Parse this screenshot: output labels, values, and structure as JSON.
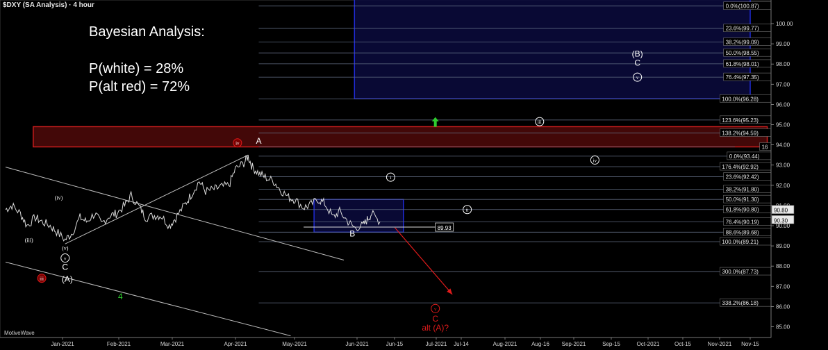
{
  "header": {
    "title": "$DXY (SA Analysis) · 4 hour"
  },
  "annotation": {
    "heading": "Bayesian Analysis:",
    "line1": "P(white) = 28%",
    "line2": "P(alt red) = 72%"
  },
  "footer": {
    "brand": "MotiveWave"
  },
  "colors": {
    "background": "#000000",
    "price": "#d9d9d9",
    "grid": "#5f6a80",
    "red_zone_fill": "#5a0b0b",
    "red_zone_stroke": "#cc1d1d",
    "blue_zone_fill": "#0a0a3d",
    "blue_zone_stroke": "#1f2bd6",
    "white_wave": "#ffffff",
    "red_wave": "#e01b1b",
    "green_wave": "#2ecc2e"
  },
  "chart_data": {
    "type": "line",
    "title": "$DXY (SA Analysis) · 4 hour",
    "xlabel": "",
    "ylabel": "",
    "x_ticks": [
      "Jan-2021",
      "Feb-2021",
      "Mar-2021",
      "Apr-2021",
      "May-2021",
      "Jun-2021",
      "Jun-15",
      "Jul-2021",
      "Jul-14",
      "Aug-2021",
      "Aug-16",
      "Sep-2021",
      "Sep-15",
      "Oct-2021",
      "Oct-15",
      "Nov-2021",
      "Nov-15"
    ],
    "y_ticks": [
      "100.00",
      "99.00",
      "98.00",
      "97.00",
      "96.00",
      "95.00",
      "94.00",
      "93.00",
      "92.00",
      "91.00",
      "90.00",
      "89.00",
      "88.00",
      "87.00",
      "86.00",
      "85.00"
    ],
    "ylim": [
      84.5,
      101.2
    ],
    "price_markers": [
      {
        "label": "90.80",
        "value": 90.8
      },
      {
        "label": "90.30",
        "value": 90.3
      }
    ],
    "fib_levels": [
      {
        "label": "0.0%(100.87)",
        "value": 100.87
      },
      {
        "label": "23.6%(99.77)",
        "value": 99.77
      },
      {
        "label": "38.2%(99.09)",
        "value": 99.09
      },
      {
        "label": "50.0%(98.55)",
        "value": 98.55
      },
      {
        "label": "61.8%(98.01)",
        "value": 98.01
      },
      {
        "label": "76.4%(97.35)",
        "value": 97.35
      },
      {
        "label": "100.0%(96.28)",
        "value": 96.28
      },
      {
        "label": "123.6%(95.23)",
        "value": 95.23
      },
      {
        "label": "138.2%(94.59)",
        "value": 94.59
      },
      {
        "label": "16",
        "value": 93.9
      },
      {
        "label": "0.0%(93.44)",
        "value": 93.44
      },
      {
        "label": "176.4%(92.92)",
        "value": 92.92
      },
      {
        "label": "23.6%(92.42)",
        "value": 92.42
      },
      {
        "label": "38.2%(91.80)",
        "value": 91.8
      },
      {
        "label": "50.0%(91.30)",
        "value": 91.3
      },
      {
        "label": "61.8%(90.80)",
        "value": 90.8
      },
      {
        "label": "76.4%(90.19)",
        "value": 90.19
      },
      {
        "label": "88.6%(89.68)",
        "value": 89.68
      },
      {
        "label": "100.0%(89.21)",
        "value": 89.21
      },
      {
        "label": "300.0%(87.73)",
        "value": 87.73
      },
      {
        "label": "338.2%(86.18)",
        "value": 86.18
      }
    ],
    "price_callout": {
      "label": "89.93",
      "value": 89.93
    },
    "price_path": [
      [
        "2020-12-07",
        90.8
      ],
      [
        "2020-12-10",
        91.0
      ],
      [
        "2020-12-14",
        90.6
      ],
      [
        "2020-12-17",
        90.0
      ],
      [
        "2020-12-21",
        90.4
      ],
      [
        "2020-12-24",
        90.2
      ],
      [
        "2020-12-28",
        90.0
      ],
      [
        "2020-12-31",
        89.7
      ],
      [
        "2021-01-04",
        89.3
      ],
      [
        "2021-01-07",
        89.6
      ],
      [
        "2021-01-11",
        90.4
      ],
      [
        "2021-01-14",
        90.2
      ],
      [
        "2021-01-18",
        90.6
      ],
      [
        "2021-01-21",
        90.1
      ],
      [
        "2021-01-25",
        90.5
      ],
      [
        "2021-01-28",
        90.6
      ],
      [
        "2021-02-01",
        91.0
      ],
      [
        "2021-02-04",
        91.5
      ],
      [
        "2021-02-08",
        90.9
      ],
      [
        "2021-02-11",
        90.4
      ],
      [
        "2021-02-15",
        90.5
      ],
      [
        "2021-02-18",
        90.5
      ],
      [
        "2021-02-22",
        90.0
      ],
      [
        "2021-02-25",
        90.4
      ],
      [
        "2021-03-01",
        91.0
      ],
      [
        "2021-03-04",
        91.5
      ],
      [
        "2021-03-08",
        92.2
      ],
      [
        "2021-03-11",
        91.7
      ],
      [
        "2021-03-15",
        91.8
      ],
      [
        "2021-03-18",
        91.9
      ],
      [
        "2021-03-22",
        92.0
      ],
      [
        "2021-03-25",
        92.8
      ],
      [
        "2021-03-29",
        93.1
      ],
      [
        "2021-03-31",
        93.43
      ],
      [
        "2021-04-02",
        92.9
      ],
      [
        "2021-04-05",
        92.6
      ],
      [
        "2021-04-08",
        92.4
      ],
      [
        "2021-04-12",
        92.2
      ],
      [
        "2021-04-15",
        91.8
      ],
      [
        "2021-04-19",
        91.4
      ],
      [
        "2021-04-22",
        91.3
      ],
      [
        "2021-04-26",
        90.9
      ],
      [
        "2021-04-29",
        91.0
      ],
      [
        "2021-05-03",
        91.3
      ],
      [
        "2021-05-06",
        91.1
      ],
      [
        "2021-05-10",
        90.4
      ],
      [
        "2021-05-13",
        90.7
      ],
      [
        "2021-05-17",
        90.2
      ],
      [
        "2021-05-20",
        89.9
      ],
      [
        "2021-05-24",
        90.0
      ],
      [
        "2021-05-26",
        90.3
      ],
      [
        "2021-05-28",
        90.6
      ],
      [
        "2021-06-01",
        90.2
      ]
    ],
    "zones": [
      {
        "name": "blue-top",
        "x0": "2021-05-20",
        "x1": "2021-11-22",
        "y0": 96.28,
        "y1": 101.2
      },
      {
        "name": "red",
        "x0": "2020-12-20",
        "x1": "2021-11-30",
        "y0": 93.9,
        "y1": 94.9
      },
      {
        "name": "blue-small",
        "x0": "2021-05-01",
        "x1": "2021-06-12",
        "y0": 89.68,
        "y1": 91.3
      }
    ],
    "trend_lines": [
      {
        "x0": "2020-12-07",
        "y0": 92.9,
        "x1": "2021-05-15",
        "y1": 88.3
      },
      {
        "x0": "2021-01-04",
        "y0": 89.1,
        "x1": "2021-03-31",
        "y1": 93.5
      },
      {
        "x0": "2020-12-07",
        "y0": 88.2,
        "x1": "2021-04-20",
        "y1": 84.55
      }
    ],
    "projection_arrow": {
      "x0": "2021-06-08",
      "y0": 89.9,
      "x1": "2021-07-05",
      "y1": 86.6
    },
    "wave_labels": [
      {
        "text": "(iv)",
        "x": "2021-01-01",
        "y": 91.4,
        "color": "white",
        "style": "small"
      },
      {
        "text": "(iii)",
        "x": "2020-12-18",
        "y": 89.3,
        "color": "white",
        "style": "small"
      },
      {
        "text": "(v)",
        "x": "2021-01-04",
        "y": 88.9,
        "color": "white",
        "style": "small"
      },
      {
        "text": "v",
        "x": "2021-01-04",
        "y": 88.4,
        "color": "white",
        "style": "circle"
      },
      {
        "text": "C",
        "x": "2021-01-04",
        "y": 87.95,
        "color": "white",
        "style": "plain"
      },
      {
        "text": "iii",
        "x": "2020-12-24",
        "y": 87.4,
        "color": "red",
        "style": "circle-fill"
      },
      {
        "text": "(A)",
        "x": "2021-01-05",
        "y": 87.35,
        "color": "white",
        "style": "plain"
      },
      {
        "text": "4",
        "x": "2021-01-30",
        "y": 86.5,
        "color": "green",
        "style": "plain"
      },
      {
        "text": "iv",
        "x": "2021-03-26",
        "y": 94.1,
        "color": "red",
        "style": "circle-fill"
      },
      {
        "text": "A",
        "x": "2021-04-05",
        "y": 94.2,
        "color": "white",
        "style": "plain"
      },
      {
        "text": "B",
        "x": "2021-05-19",
        "y": 89.6,
        "color": "white",
        "style": "plain"
      },
      {
        "text": "i",
        "x": "2021-06-06",
        "y": 92.4,
        "color": "white",
        "style": "circle"
      },
      {
        "text": "ii",
        "x": "2021-07-12",
        "y": 90.8,
        "color": "white",
        "style": "circle"
      },
      {
        "text": "iii",
        "x": "2021-08-15",
        "y": 95.15,
        "color": "white",
        "style": "circle"
      },
      {
        "text": "iv",
        "x": "2021-09-10",
        "y": 93.25,
        "color": "white",
        "style": "circle"
      },
      {
        "text": "(B)",
        "x": "2021-09-30",
        "y": 98.5,
        "color": "white",
        "style": "plain"
      },
      {
        "text": "C",
        "x": "2021-09-30",
        "y": 98.05,
        "color": "white",
        "style": "plain"
      },
      {
        "text": "v",
        "x": "2021-09-30",
        "y": 97.35,
        "color": "white",
        "style": "circle"
      },
      {
        "text": "v",
        "x": "2021-06-27",
        "y": 85.9,
        "color": "red",
        "style": "circle-outline"
      },
      {
        "text": "C",
        "x": "2021-06-27",
        "y": 85.4,
        "color": "red",
        "style": "plain"
      },
      {
        "text": "alt (A)?",
        "x": "2021-06-27",
        "y": 84.95,
        "color": "red",
        "style": "plain"
      }
    ],
    "up_arrow": {
      "x": "2021-06-27",
      "y": 95.1
    },
    "grid": false,
    "legend": "none"
  }
}
